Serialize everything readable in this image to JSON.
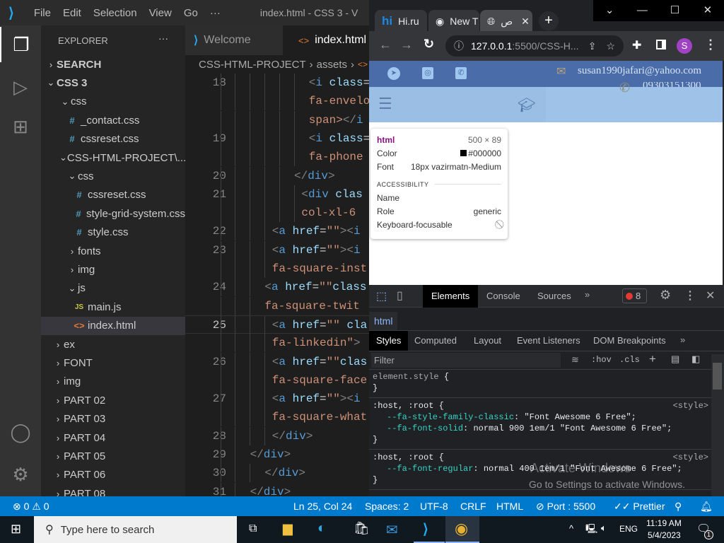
{
  "vscode": {
    "menu": [
      "File",
      "Edit",
      "Selection",
      "View",
      "Go",
      "···"
    ],
    "window_title": "index.html - CSS 3 - V",
    "explorer_title": "EXPLORER",
    "explorer_more": "···",
    "tree": [
      {
        "label": "SEARCH",
        "depth": 0,
        "kind": "section",
        "open": false
      },
      {
        "label": "CSS 3",
        "depth": 0,
        "kind": "section",
        "open": true
      },
      {
        "label": "css",
        "depth": 1,
        "kind": "folder",
        "open": true
      },
      {
        "label": "_contact.css",
        "depth": 1,
        "kind": "css"
      },
      {
        "label": "cssreset.css",
        "depth": 1,
        "kind": "css"
      },
      {
        "label": "CSS-HTML-PROJECT\\...",
        "depth": 1,
        "kind": "folder",
        "open": true
      },
      {
        "label": "css",
        "depth": 2,
        "kind": "folder",
        "open": true
      },
      {
        "label": "cssreset.css",
        "depth": 2,
        "kind": "css"
      },
      {
        "label": "style-grid-system.css",
        "depth": 2,
        "kind": "css"
      },
      {
        "label": "style.css",
        "depth": 2,
        "kind": "css"
      },
      {
        "label": "fonts",
        "depth": 2,
        "kind": "folder",
        "open": false
      },
      {
        "label": "img",
        "depth": 2,
        "kind": "folder",
        "open": false
      },
      {
        "label": "js",
        "depth": 2,
        "kind": "folder",
        "open": true
      },
      {
        "label": "main.js",
        "depth": 2,
        "kind": "js"
      },
      {
        "label": "index.html",
        "depth": 2,
        "kind": "html",
        "selected": true
      },
      {
        "label": "ex",
        "depth": 0,
        "kind": "folder",
        "open": false
      },
      {
        "label": "FONT",
        "depth": 0,
        "kind": "folder",
        "open": false
      },
      {
        "label": "img",
        "depth": 0,
        "kind": "folder",
        "open": false
      },
      {
        "label": "PART 02",
        "depth": 0,
        "kind": "folder",
        "open": false
      },
      {
        "label": "PART 03",
        "depth": 0,
        "kind": "folder",
        "open": false
      },
      {
        "label": "PART 04",
        "depth": 0,
        "kind": "folder",
        "open": false
      },
      {
        "label": "PART 05",
        "depth": 0,
        "kind": "folder",
        "open": false
      },
      {
        "label": "PART 06",
        "depth": 0,
        "kind": "folder",
        "open": false
      },
      {
        "label": "PART 08",
        "depth": 0,
        "kind": "folder",
        "open": false
      }
    ],
    "tabs": [
      {
        "label": "Welcome",
        "active": false
      },
      {
        "label": "index.html",
        "active": true
      }
    ],
    "breadcrumb": [
      "CSS-HTML-PROJECT",
      "assets"
    ],
    "code_rows": [
      {
        "ln": "18",
        "indent": 17,
        "seg": [
          [
            "<",
            "pun"
          ],
          [
            "i ",
            "tag"
          ],
          [
            "class",
            "attr"
          ],
          [
            "=",
            "txt"
          ]
        ]
      },
      {
        "ln": "",
        "indent": 17,
        "seg": [
          [
            "fa-envelo",
            "str"
          ]
        ]
      },
      {
        "ln": "",
        "indent": 17,
        "seg": [
          [
            "span>",
            "str"
          ],
          [
            "</",
            "pun"
          ],
          [
            "i",
            "tag"
          ]
        ]
      },
      {
        "ln": "19",
        "indent": 17,
        "seg": [
          [
            "<",
            "pun"
          ],
          [
            "i ",
            "tag"
          ],
          [
            "class",
            "attr"
          ],
          [
            "=",
            "txt"
          ]
        ]
      },
      {
        "ln": "",
        "indent": 17,
        "seg": [
          [
            "fa-phone",
            "str"
          ]
        ]
      },
      {
        "ln": "20",
        "indent": 15,
        "seg": [
          [
            "</",
            "pun"
          ],
          [
            "div",
            "tag"
          ],
          [
            ">",
            "pun"
          ]
        ]
      },
      {
        "ln": "21",
        "indent": 16,
        "seg": [
          [
            "<",
            "pun"
          ],
          [
            "div ",
            "tag"
          ],
          [
            "clas",
            "attr"
          ]
        ]
      },
      {
        "ln": "",
        "indent": 16,
        "seg": [
          [
            "col-xl-6 ",
            "str"
          ]
        ]
      },
      {
        "ln": "22",
        "indent": 12,
        "seg": [
          [
            "<",
            "pun"
          ],
          [
            "a ",
            "tag"
          ],
          [
            "href",
            "attr"
          ],
          [
            "=",
            "txt"
          ],
          [
            "\"\"",
            "str"
          ],
          [
            "><",
            "pun"
          ],
          [
            "i",
            "tag"
          ]
        ]
      },
      {
        "ln": "23",
        "indent": 12,
        "seg": [
          [
            "<",
            "pun"
          ],
          [
            "a ",
            "tag"
          ],
          [
            "href",
            "attr"
          ],
          [
            "=",
            "txt"
          ],
          [
            "\"\"",
            "str"
          ],
          [
            "><",
            "pun"
          ],
          [
            "i",
            "tag"
          ]
        ]
      },
      {
        "ln": "",
        "indent": 12,
        "seg": [
          [
            "fa-square-inst",
            "str"
          ]
        ]
      },
      {
        "ln": "24",
        "indent": 11,
        "seg": [
          [
            "<",
            "pun"
          ],
          [
            "a ",
            "tag"
          ],
          [
            "href",
            "attr"
          ],
          [
            "=",
            "txt"
          ],
          [
            "\"\"",
            "str"
          ],
          [
            "class",
            "attr"
          ]
        ]
      },
      {
        "ln": "",
        "indent": 11,
        "seg": [
          [
            "fa-square-twit",
            "str"
          ]
        ]
      },
      {
        "ln": "25",
        "indent": 12,
        "current": true,
        "seg": [
          [
            "<",
            "pun"
          ],
          [
            "a ",
            "tag"
          ],
          [
            "href",
            "attr"
          ],
          [
            "=",
            "txt"
          ],
          [
            "\"\" ",
            "str"
          ],
          [
            "cla",
            "attr"
          ]
        ]
      },
      {
        "ln": "",
        "indent": 12,
        "seg": [
          [
            "fa-linkedin\"",
            "str"
          ],
          [
            ">",
            "pun"
          ]
        ]
      },
      {
        "ln": "26",
        "indent": 12,
        "seg": [
          [
            "<",
            "pun"
          ],
          [
            "a ",
            "tag"
          ],
          [
            "href",
            "attr"
          ],
          [
            "=",
            "txt"
          ],
          [
            "\"\"",
            "str"
          ],
          [
            "clas",
            "attr"
          ]
        ]
      },
      {
        "ln": "",
        "indent": 12,
        "seg": [
          [
            "fa-square-face",
            "str"
          ]
        ]
      },
      {
        "ln": "27",
        "indent": 12,
        "seg": [
          [
            "<",
            "pun"
          ],
          [
            "a ",
            "tag"
          ],
          [
            "href",
            "attr"
          ],
          [
            "=",
            "txt"
          ],
          [
            "\"\"",
            "str"
          ],
          [
            "><",
            "pun"
          ],
          [
            "i",
            "tag"
          ]
        ]
      },
      {
        "ln": "",
        "indent": 12,
        "seg": [
          [
            "fa-square-what",
            "str"
          ]
        ]
      },
      {
        "ln": "28",
        "indent": 12,
        "seg": [
          [
            "</",
            "pun"
          ],
          [
            "div",
            "tag"
          ],
          [
            ">",
            "pun"
          ]
        ]
      },
      {
        "ln": "29",
        "indent": 9,
        "seg": [
          [
            "</",
            "pun"
          ],
          [
            "div",
            "tag"
          ],
          [
            ">",
            "pun"
          ]
        ]
      },
      {
        "ln": "30",
        "indent": 11,
        "seg": [
          [
            "</",
            "pun"
          ],
          [
            "div",
            "tag"
          ],
          [
            ">",
            "pun"
          ]
        ]
      },
      {
        "ln": "31",
        "indent": 9,
        "seg": [
          [
            "</",
            "pun"
          ],
          [
            "div",
            "tag"
          ],
          [
            ">",
            "pun"
          ]
        ]
      }
    ]
  },
  "statusbar": {
    "errors": "0",
    "warnings": "0",
    "position": "Ln 25, Col 24",
    "spaces": "Spaces: 2",
    "encoding": "UTF-8",
    "eol": "CRLF",
    "language": "HTML",
    "port": "Port : 5500",
    "prettier": "Prettier"
  },
  "taskbar": {
    "search_placeholder": "Type here to search",
    "time": "11:19 AM",
    "date": "5/4/2023",
    "lang": "ENG",
    "notifications": "1"
  },
  "browser": {
    "tabs": [
      {
        "label": "Hi.ru",
        "icon": "hi"
      },
      {
        "label": "New T",
        "icon": "chrome"
      },
      {
        "label": "ص",
        "icon": "globe",
        "active": true
      }
    ],
    "url_host": "127.0.0.1",
    "url_rest": ":5500/CSS-H...",
    "profile_initial": "S",
    "page": {
      "email": "susan1990jafari@yahoo.com",
      "phone": "09303151300",
      "colors": {
        "topbar": "#4a6ca9",
        "navbar": "#9fc3e8"
      }
    },
    "tooltip": {
      "tag": "html",
      "size": "500 × 89",
      "color_label": "Color",
      "color_value": "#000000",
      "font_label": "Font",
      "font_value": "18px vazirmatn-Medium",
      "section": "ACCESSIBILITY",
      "name_label": "Name",
      "role_label": "Role",
      "role_value": "generic",
      "focus_label": "Keyboard-focusable"
    },
    "devtools": {
      "tabs": [
        "Elements",
        "Console",
        "Sources"
      ],
      "error_count": "8",
      "breadcrumb": "html",
      "subtabs": [
        "Styles",
        "Computed",
        "Layout",
        "Event Listeners",
        "DOM Breakpoints"
      ],
      "filter_placeholder": "Filter",
      "hov": ":hov",
      "cls": ".cls",
      "rules": [
        {
          "selector": "element.style",
          "source": "",
          "props": []
        },
        {
          "selector": ":host, :root",
          "source": "<style>",
          "props": [
            [
              "--fa-style-family-classic",
              "\"Font Awesome 6 Free\";"
            ],
            [
              "--fa-font-solid",
              "normal 900 1em/1 \"Font Awesome 6 Free\";"
            ]
          ]
        },
        {
          "selector": ":host, :root",
          "source": "<style>",
          "props": [
            [
              "--fa-font-regular",
              "normal 400 1em/1 \"Font Awesome 6 Free\";"
            ]
          ]
        }
      ]
    }
  },
  "watermark": {
    "line1": "Activate Windows",
    "line2": "Go to Settings to activate Windows."
  }
}
